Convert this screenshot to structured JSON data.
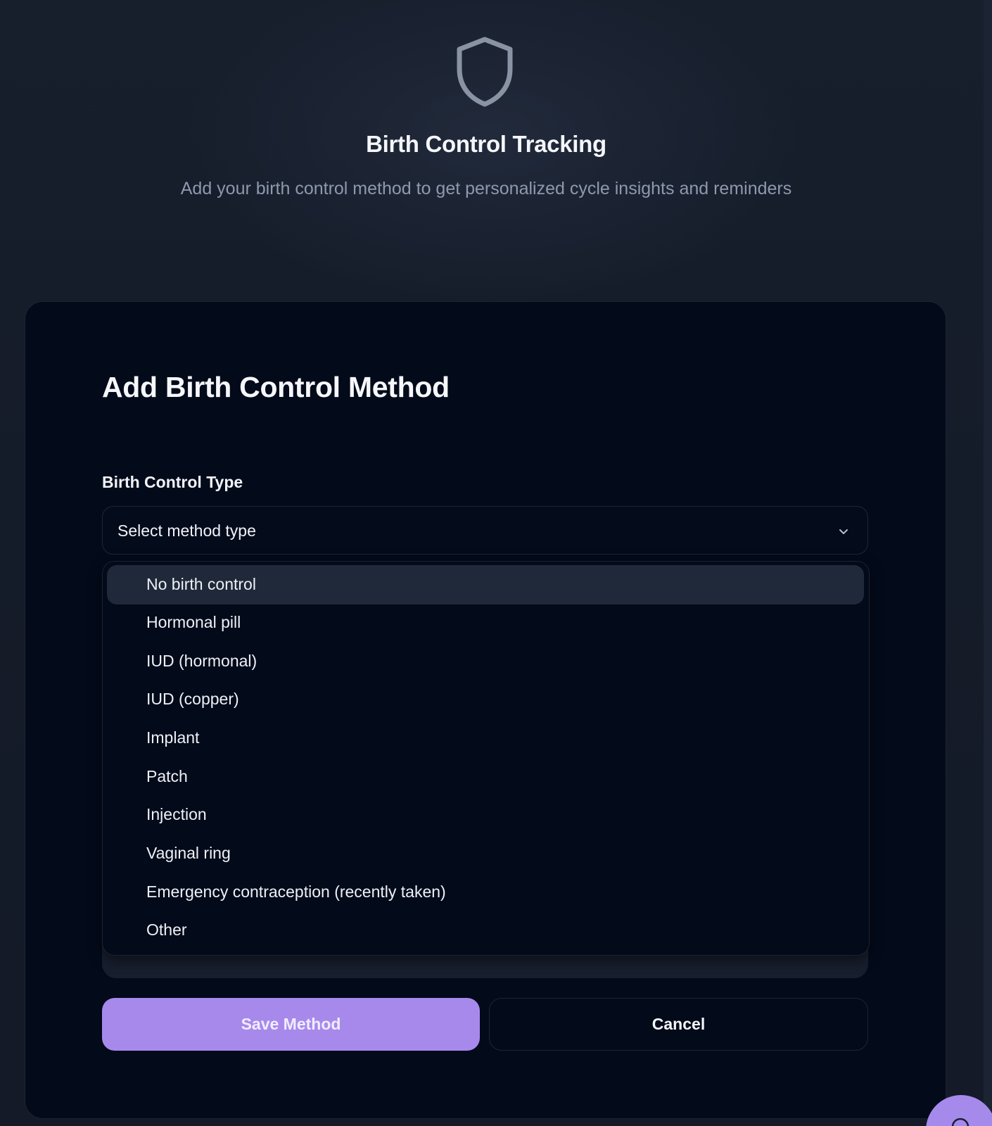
{
  "header": {
    "icon": "shield-icon",
    "title": "Birth Control Tracking",
    "subtitle": "Add your birth control method to get personalized cycle insights and reminders"
  },
  "form": {
    "title": "Add Birth Control Method",
    "type_label": "Birth Control Type",
    "select_placeholder": "Select method type",
    "options": [
      "No birth control",
      "Hormonal pill",
      "IUD (hormonal)",
      "IUD (copper)",
      "Implant",
      "Patch",
      "Injection",
      "Vaginal ring",
      "Emergency contraception (recently taken)",
      "Other"
    ],
    "highlighted_option": "No birth control",
    "save_label": "Save Method",
    "cancel_label": "Cancel"
  },
  "colors": {
    "background": "#161d2b",
    "card": "#030a1a",
    "accent": "#a789ec",
    "muted_text": "#8e99ad"
  }
}
